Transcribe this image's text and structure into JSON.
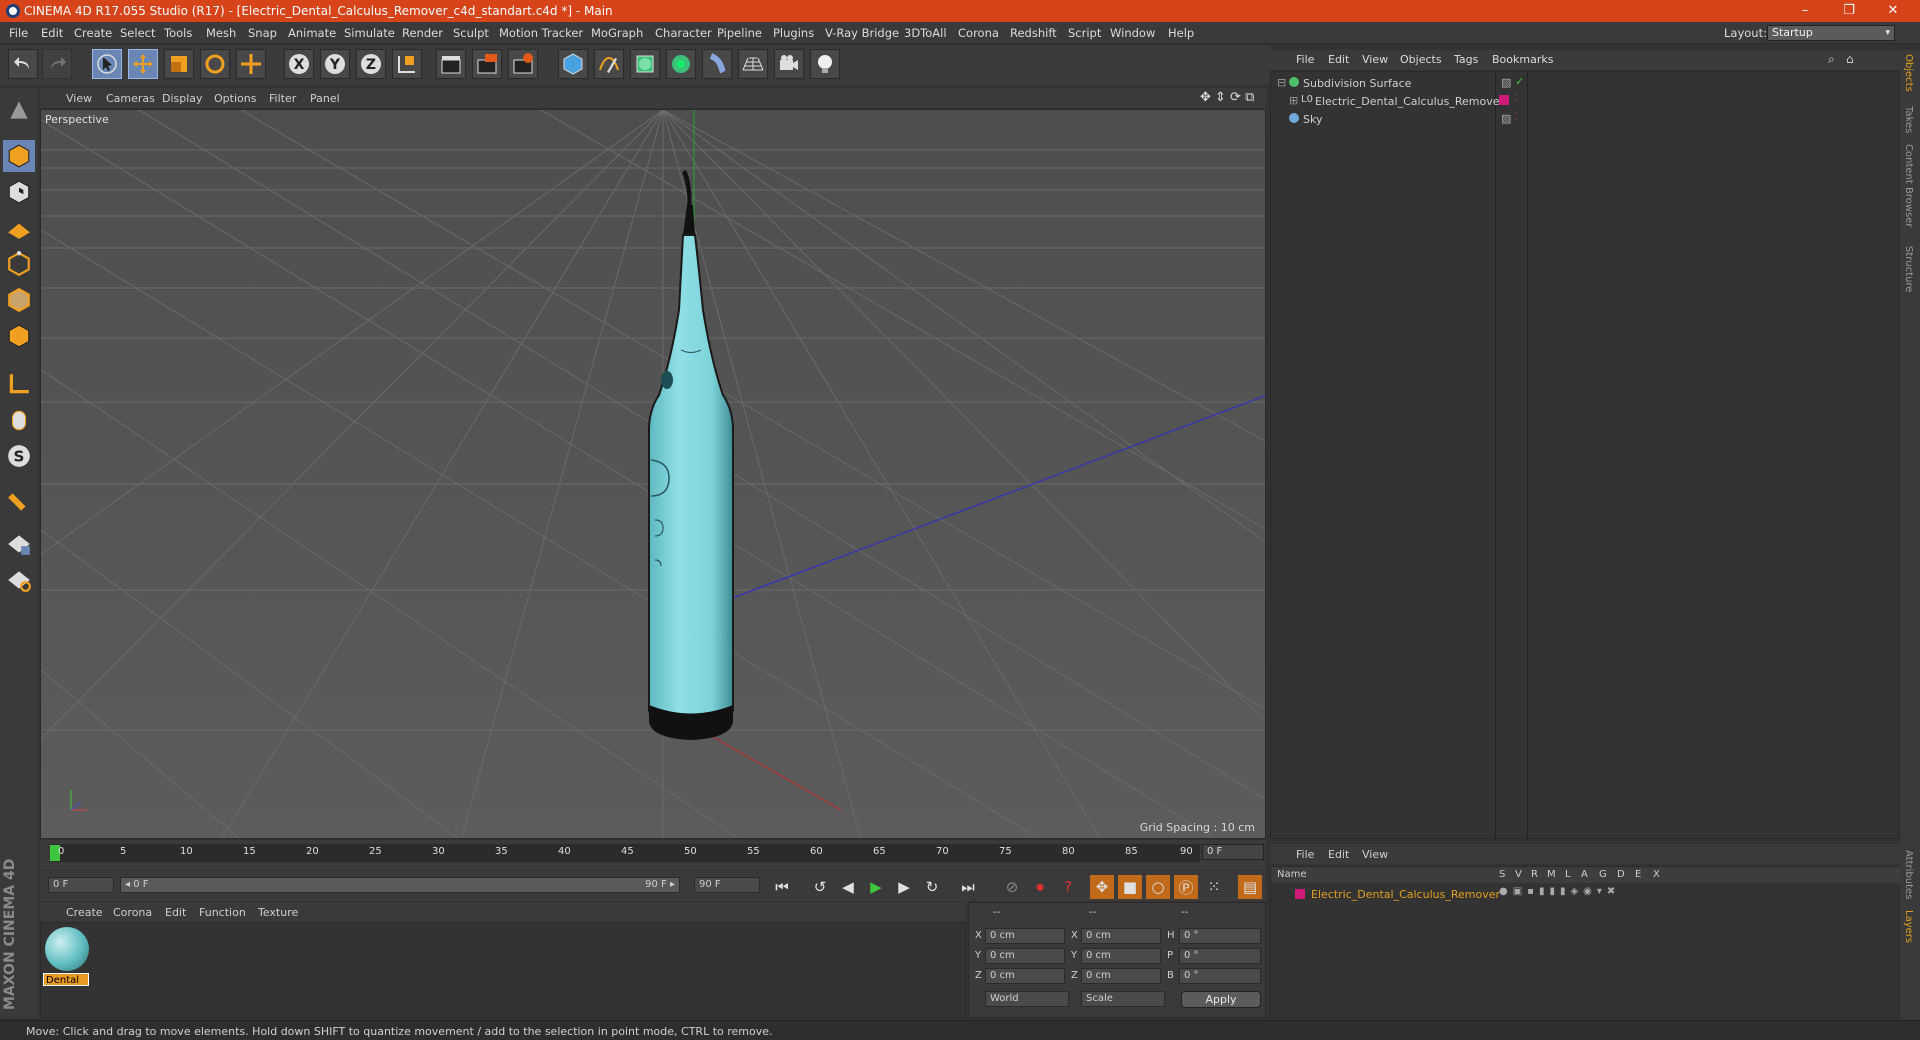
{
  "window": {
    "title": "CINEMA 4D R17.055 Studio (R17) - [Electric_Dental_Calculus_Remover_c4d_standart.c4d *] - Main",
    "minimize": "–",
    "restore": "❐",
    "close": "✕"
  },
  "menubar": {
    "items": [
      "File",
      "Edit",
      "Create",
      "Select",
      "Tools",
      "Mesh",
      "Snap",
      "Animate",
      "Simulate",
      "Render",
      "Sculpt",
      "Motion Tracker",
      "MoGraph",
      "Character",
      "Pipeline",
      "Plugins",
      "V-Ray Bridge",
      "3DToAll",
      "Corona",
      "Redshift",
      "Script",
      "Window",
      "Help"
    ]
  },
  "layout": {
    "label": "Layout:",
    "value": "Startup"
  },
  "toolbar": {
    "axis_labels": [
      "X",
      "Y",
      "Z"
    ]
  },
  "viewport": {
    "menu": [
      "View",
      "Cameras",
      "Display",
      "Options",
      "Filter",
      "Panel"
    ],
    "camera": "Perspective",
    "grid_spacing": "Grid Spacing : 10 cm"
  },
  "timeline": {
    "ticks": [
      "0",
      "5",
      "10",
      "15",
      "20",
      "25",
      "30",
      "35",
      "40",
      "45",
      "50",
      "55",
      "60",
      "65",
      "70",
      "75",
      "80",
      "85",
      "90"
    ],
    "current_frame_field": "0 F"
  },
  "transport": {
    "start_field": "0 F",
    "range_start": "◂ 0 F",
    "range_end": "90 F ▸",
    "end_field": "90 F"
  },
  "material_manager": {
    "menu": [
      "Create",
      "Corona",
      "Edit",
      "Function",
      "Texture"
    ],
    "materials": [
      {
        "name": "Dental"
      }
    ]
  },
  "coordinates": {
    "headers": [
      "--",
      "--",
      "--"
    ],
    "rows": [
      {
        "axis": "X",
        "pos": "0 cm",
        "size_axis": "X",
        "size": "0 cm",
        "rot_axis": "H",
        "rot": "0 °"
      },
      {
        "axis": "Y",
        "pos": "0 cm",
        "size_axis": "Y",
        "size": "0 cm",
        "rot_axis": "P",
        "rot": "0 °"
      },
      {
        "axis": "Z",
        "pos": "0 cm",
        "size_axis": "Z",
        "size": "0 cm",
        "rot_axis": "B",
        "rot": "0 °"
      }
    ],
    "mode": "World",
    "transform": "Scale",
    "apply": "Apply"
  },
  "object_manager": {
    "menu": [
      "File",
      "Edit",
      "View",
      "Objects",
      "Tags",
      "Bookmarks"
    ],
    "objects": [
      {
        "name": "Subdivision Surface",
        "color": "#4fc06a"
      },
      {
        "name": "Electric_Dental_Calculus_Remover",
        "color": "#d01a7a"
      },
      {
        "name": "Sky",
        "color": "#6fa8dc"
      }
    ]
  },
  "right_tabs": [
    "Objects",
    "Takes",
    "Content Browser",
    "Structure",
    "Attributes",
    "Layers"
  ],
  "layer_manager": {
    "menu": [
      "File",
      "Edit",
      "View"
    ],
    "columns": [
      "Name",
      "S",
      "V",
      "R",
      "M",
      "L",
      "A",
      "G",
      "D",
      "E",
      "X"
    ],
    "layers": [
      {
        "name": "Electric_Dental_Calculus_Remover",
        "color": "#d01a7a"
      }
    ]
  },
  "branding": "MAXON CINEMA 4D",
  "status": "Move: Click and drag to move elements. Hold down SHIFT to quantize movement / add to the selection in point mode, CTRL to remove."
}
